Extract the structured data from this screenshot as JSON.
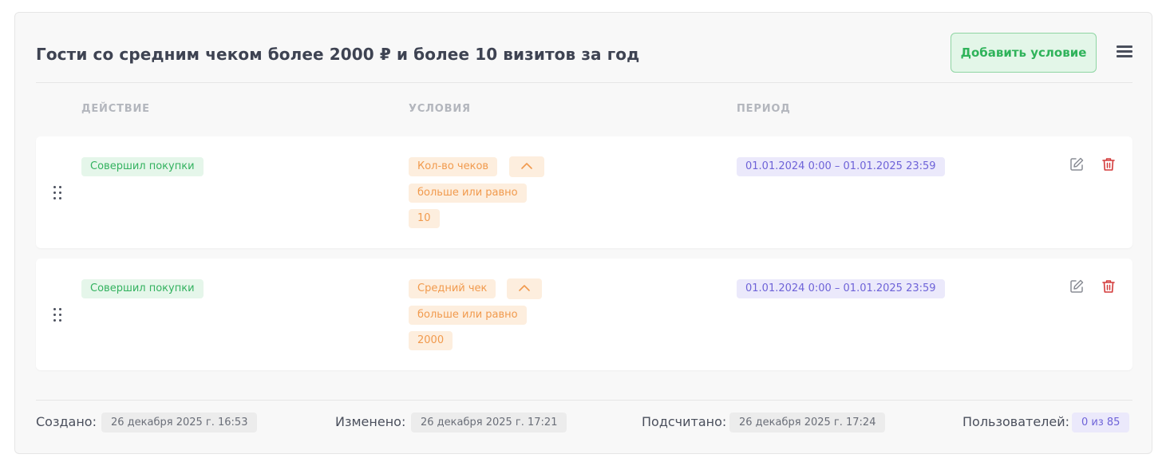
{
  "header": {
    "title": "Гости со средним чеком более 2000 ₽ и более 10 визитов за год",
    "add_button_label": "Добавить условие",
    "menu_icon": "hamburger-menu-icon"
  },
  "columns": {
    "action": "ДЕЙСТВИЕ",
    "conditions": "УСЛОВИЯ",
    "period": "ПЕРИОД"
  },
  "rows": [
    {
      "action": "Совершил покупки",
      "condition_field": "Кол-во чеков",
      "condition_operator": "больше или равно",
      "condition_value": "10",
      "period": "01.01.2024 0:00 – 01.01.2025 23:59"
    },
    {
      "action": "Совершил покупки",
      "condition_field": "Средний чек",
      "condition_operator": "больше или равно",
      "condition_value": "2000",
      "period": "01.01.2024 0:00 – 01.01.2025 23:59"
    }
  ],
  "footer": {
    "created_label": "Создано:",
    "created_value": "26 декабря 2025 г. 16:53",
    "modified_label": "Изменено:",
    "modified_value": "26 декабря 2025 г. 17:21",
    "counted_label": "Подсчитано:",
    "counted_value": "26 декабря 2025 г. 17:24",
    "users_label": "Пользователей:",
    "users_value": "0 из 85"
  },
  "colors": {
    "accent_green": "#2fb35a",
    "chip_orange": "#f19a4d",
    "chip_purple": "#6e63d8",
    "delete_red": "#d33a3a"
  }
}
